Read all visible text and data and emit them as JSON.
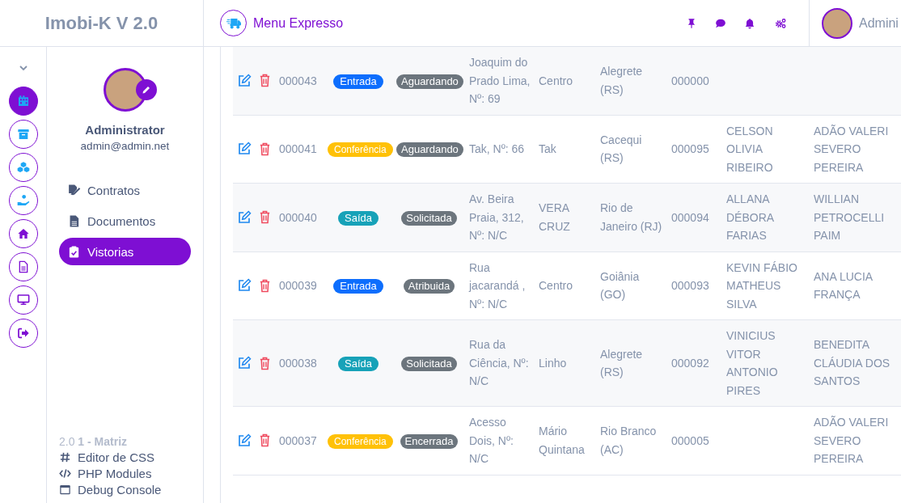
{
  "header": {
    "logo": "Imobi-K V 2.0",
    "menu_button": "Menu Expresso",
    "user_name": "Admini"
  },
  "rail": [
    {
      "selected": true
    },
    {
      "selected": false
    },
    {
      "selected": false
    },
    {
      "selected": false
    },
    {
      "selected": false
    },
    {
      "selected": false
    },
    {
      "selected": false
    },
    {
      "selected": false
    }
  ],
  "profile": {
    "name": "Administrator",
    "email": "admin@admin.net"
  },
  "nav": [
    {
      "label": "Contratos",
      "selected": false
    },
    {
      "label": "Documentos",
      "selected": false
    },
    {
      "label": "Vistorias",
      "selected": true
    }
  ],
  "footer": {
    "version": "2.0 **1 - Matriz**",
    "links": [
      "Editor de CSS",
      "PHP Modules",
      "Debug Console"
    ]
  },
  "rows": [
    {
      "code": "000043",
      "type": {
        "label": "Entrada",
        "color": "#0d6efd"
      },
      "status": "Aguardando",
      "column_4": "Joaquim do Prado Lima, Nº: 69",
      "column_5": "Centro",
      "column_6": "Alegrete (RS)",
      "column_7": "000000"
    },
    {
      "code": "000041",
      "type": {
        "label": "Conferência",
        "color": "#ffc107"
      },
      "status": "Aguardando",
      "column_4": "Tak, Nº: 66",
      "column_5": "Tak",
      "column_6": "Cacequi (RS)",
      "column_7": "000095",
      "column_8": "CELSON OLIVIA RIBEIRO",
      "column_9": "ADÃO VALERI SEVERO PEREIRA"
    },
    {
      "code": "000040",
      "type": {
        "label": "Saída",
        "color": "#17a2b8"
      },
      "status": "Solicitada",
      "column_4": "Av. Beira Praia, 312, Nº: N/C",
      "column_5": "VERA CRUZ",
      "column_6": "Rio de Janeiro (RJ)",
      "column_7": "000094",
      "column_8": "ALLANA DÉBORA FARIAS",
      "column_9": "WILLIAN PETROCELLI PAIM"
    },
    {
      "code": "000039",
      "type": {
        "label": "Entrada",
        "color": "#0d6efd"
      },
      "status": "Atribuida",
      "column_4": "Rua jacarandá , Nº: N/C",
      "column_5": "Centro",
      "column_6": "Goiânia (GO)",
      "column_7": "000093",
      "column_8": "KEVIN FÁBIO MATHEUS SILVA",
      "column_9": "ANA LUCIA FRANÇA"
    },
    {
      "code": "000038",
      "type": {
        "label": "Saída",
        "color": "#17a2b8"
      },
      "status": "Solicitada",
      "column_4": "Rua da Ciência, Nº: N/C",
      "column_5": "Linho",
      "column_6": "Alegrete (RS)",
      "column_7": "000092",
      "column_8": "VINICIUS VITOR ANTONIO PIRES",
      "column_9": "BENEDITA CLÁUDIA DOS SANTOS"
    },
    {
      "code": "000037",
      "type": {
        "label": "Conferência",
        "color": "#ffc107"
      },
      "status": "Encerrada",
      "column_4": "Acesso Dois, Nº: N/C",
      "column_5": "Mário Quintana",
      "column_6": "Rio Branco (AC)",
      "column_7": "000005",
      "column_9": "ADÃO VALERI SEVERO PEREIRA"
    }
  ]
}
